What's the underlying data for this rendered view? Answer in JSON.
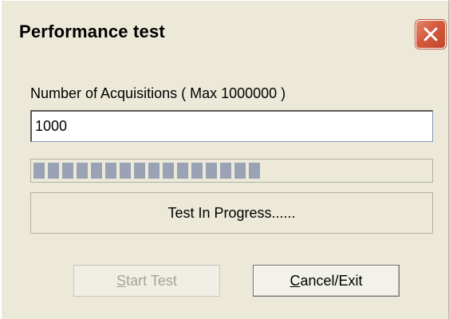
{
  "window": {
    "title": "Performance test",
    "close_icon": "close-icon",
    "close_color": "#d55a3e"
  },
  "acquisitions": {
    "label": "Number of Acquisitions ( Max 1000000 )",
    "value": "1000"
  },
  "progress": {
    "fraction": 0.6
  },
  "status": {
    "text": "Test In Progress......"
  },
  "buttons": {
    "start": {
      "mnemonic": "S",
      "rest": "tart Test",
      "enabled": false
    },
    "cancel": {
      "mnemonic": "C",
      "rest": "ancel/Exit",
      "enabled": true
    }
  }
}
